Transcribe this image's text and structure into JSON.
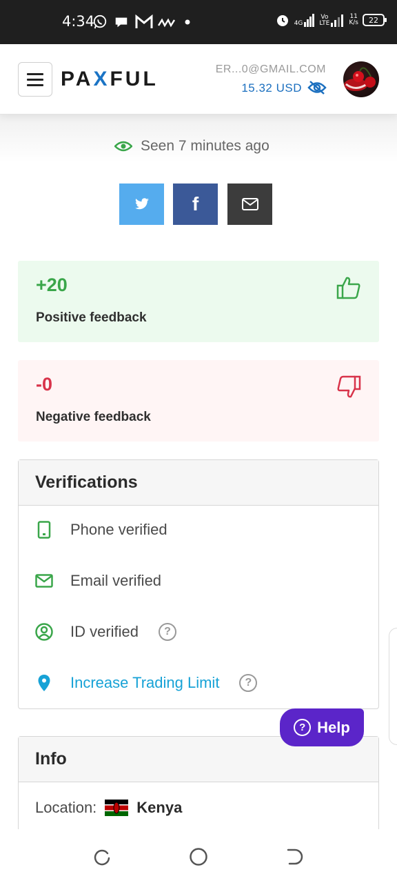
{
  "status_bar": {
    "time": "4:34",
    "network_4g": "4G",
    "volte_top": "Vo",
    "volte_bottom": "LTE",
    "speed_value": "11",
    "speed_unit": "K/s",
    "battery": "22"
  },
  "header": {
    "logo_left": "PA",
    "logo_x": "X",
    "logo_right": "FUL",
    "email": "ER...0@GMAIL.COM",
    "balance": "15.32  USD"
  },
  "profile": {
    "last_seen": "Seen 7 minutes ago"
  },
  "share": {
    "facebook_glyph": "f"
  },
  "feedback": {
    "positive": {
      "count": "+20",
      "label": "Positive feedback",
      "color": "#3aa64a"
    },
    "negative": {
      "count": "-0",
      "label": "Negative feedback",
      "color": "#d8334a"
    }
  },
  "verifications": {
    "title": "Verifications",
    "items": [
      {
        "label": "Phone verified",
        "icon": "phone-icon"
      },
      {
        "label": "Email verified",
        "icon": "envelope-icon"
      },
      {
        "label": "ID verified",
        "icon": "id-user-icon",
        "help": true
      },
      {
        "label": "Increase Trading Limit",
        "icon": "location-pin-icon",
        "link": true,
        "help": true
      }
    ]
  },
  "info": {
    "title": "Info",
    "location_label": "Location:",
    "country": "Kenya"
  },
  "help_button": {
    "label": "Help",
    "color": "#5b25c9"
  }
}
